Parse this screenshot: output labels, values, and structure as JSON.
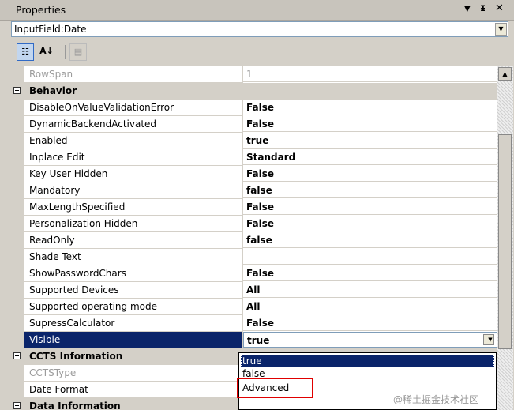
{
  "panel": {
    "title": "Properties"
  },
  "selector": {
    "value": "InputField:Date"
  },
  "properties_top": [
    {
      "name": "RowSpan",
      "value": "1",
      "disabled": true
    }
  ],
  "behavior": {
    "label": "Behavior",
    "rows": [
      {
        "name": "DisableOnValueValidationError",
        "value": "False"
      },
      {
        "name": "DynamicBackendActivated",
        "value": "False"
      },
      {
        "name": "Enabled",
        "value": "true"
      },
      {
        "name": "Inplace Edit",
        "value": "Standard"
      },
      {
        "name": "Key User Hidden",
        "value": "False"
      },
      {
        "name": "Mandatory",
        "value": "false"
      },
      {
        "name": "MaxLengthSpecified",
        "value": "False"
      },
      {
        "name": "Personalization Hidden",
        "value": "False"
      },
      {
        "name": "ReadOnly",
        "value": "false"
      },
      {
        "name": "Shade Text",
        "value": ""
      },
      {
        "name": "ShowPasswordChars",
        "value": "False"
      },
      {
        "name": "Supported Devices",
        "value": "All"
      },
      {
        "name": "Supported operating mode",
        "value": "All"
      },
      {
        "name": "SupressCalculator",
        "value": "False"
      },
      {
        "name": "Visible",
        "value": "true"
      }
    ]
  },
  "ccts": {
    "label": "CCTS Information",
    "rows": [
      {
        "name": "CCTSType",
        "value": "",
        "disabled": true
      },
      {
        "name": "Date Format",
        "value": ""
      }
    ]
  },
  "next_category": {
    "label": "Data Information"
  },
  "dropdown": {
    "options": [
      "true",
      "false",
      "Advanced"
    ],
    "selected": "true"
  },
  "watermark": "@稀土掘金技术社区",
  "colors": {
    "selection": "#0a246a",
    "highlight_box": "#e00000"
  },
  "icons": [
    "pin-icon",
    "close-icon",
    "categorized-icon",
    "alphabetical-icon",
    "property-pages-icon"
  ]
}
